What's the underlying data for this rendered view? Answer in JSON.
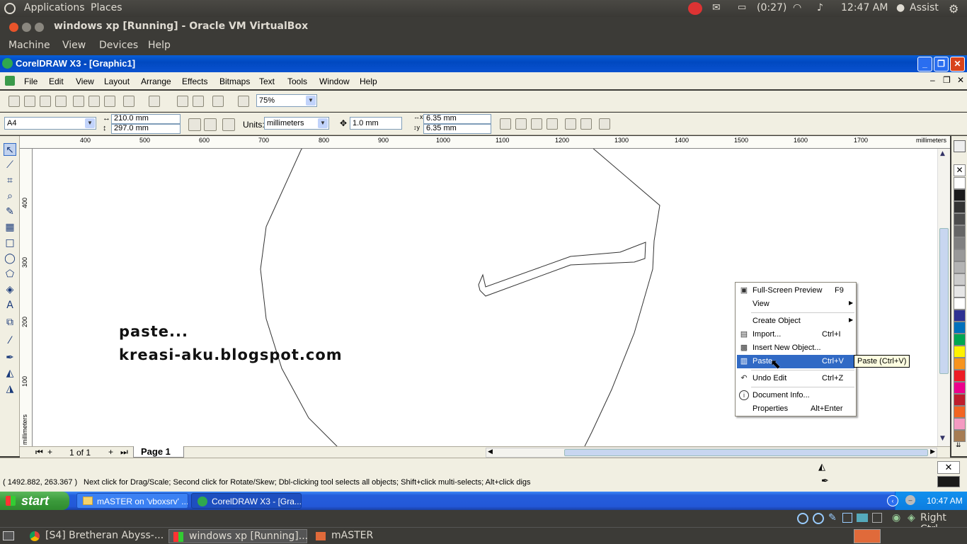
{
  "ubuntu_panel": {
    "applications": "Applications",
    "places": "Places",
    "battery": "(0:27)",
    "clock": "12:47 AM",
    "user": "Assist"
  },
  "vbox": {
    "title": "windows xp [Running] - Oracle VM VirtualBox",
    "menu": [
      "Machine",
      "View",
      "Devices",
      "Help"
    ],
    "host_key": "Right Ctrl"
  },
  "corel": {
    "title": "CorelDRAW X3 - [Graphic1]",
    "menu": [
      "File",
      "Edit",
      "View",
      "Layout",
      "Arrange",
      "Effects",
      "Bitmaps",
      "Text",
      "Tools",
      "Window",
      "Help"
    ],
    "zoom": "75%",
    "page_size": "A4",
    "width": "210.0 mm",
    "height": "297.0 mm",
    "units_label": "Units:",
    "units": "millimeters",
    "nudge": "1.0 mm",
    "dup_x": "6.35 mm",
    "dup_y": "6.35 mm",
    "ruler_top": [
      "400",
      "500",
      "600",
      "700",
      "800",
      "900",
      "1000",
      "1100",
      "1200",
      "1300",
      "1400",
      "1500",
      "1600",
      "1700",
      "millimeters"
    ],
    "ruler_left": [
      "400",
      "300",
      "200",
      "100",
      "millimeters"
    ],
    "page_counter": "1 of 1",
    "page_tab": "Page 1",
    "canvas_text_1": "paste...",
    "canvas_text_2": "kreasi-aku.blogspot.com",
    "status_coords": "( 1492.882, 263.367 )",
    "status_hint": "Next click for Drag/Scale; Second click for Rotate/Skew; Dbl-clicking tool selects all objects; Shift+click multi-selects; Alt+click digs"
  },
  "context_menu": {
    "items": [
      {
        "label": "Full-Screen Preview",
        "shortcut": "F9",
        "icon": "preview-icon"
      },
      {
        "label": "View",
        "shortcut": "",
        "icon": "",
        "submenu": true
      },
      {
        "label": "Create Object",
        "shortcut": "",
        "icon": "",
        "submenu": true
      },
      {
        "label": "Import...",
        "shortcut": "Ctrl+I",
        "icon": "import-icon"
      },
      {
        "label": "Insert New Object...",
        "shortcut": "",
        "icon": "insert-object-icon"
      },
      {
        "label": "Paste",
        "shortcut": "Ctrl+V",
        "icon": "paste-icon"
      },
      {
        "label": "Undo Edit",
        "shortcut": "Ctrl+Z",
        "icon": "undo-icon"
      },
      {
        "label": "Document Info...",
        "shortcut": "",
        "icon": "info-icon"
      },
      {
        "label": "Properties",
        "shortcut": "Alt+Enter",
        "icon": ""
      }
    ],
    "tooltip": "Paste (Ctrl+V)"
  },
  "xp_taskbar": {
    "start": "start",
    "buttons": [
      "mASTER on 'vboxsrv' ...",
      "CorelDRAW X3 - [Gra..."
    ],
    "clock": "10:47 AM"
  },
  "ubuntu_bottom": {
    "tasks": [
      "[S4] Bretheran Abyss-...",
      "windows xp [Running]...",
      "mASTER"
    ]
  },
  "palette_colors": [
    "#ffffff",
    "#1a1a1a",
    "#333333",
    "#4d4d4d",
    "#666666",
    "#808080",
    "#999999",
    "#b3b3b3",
    "#cccccc",
    "#e6e6e6",
    "#ffffff",
    "#2e3192",
    "#0071bc",
    "#00a651",
    "#fff200",
    "#f7941d",
    "#ed1c24",
    "#ec008c",
    "#be1e2d",
    "#f26522",
    "#f49ac1",
    "#a67c52"
  ]
}
